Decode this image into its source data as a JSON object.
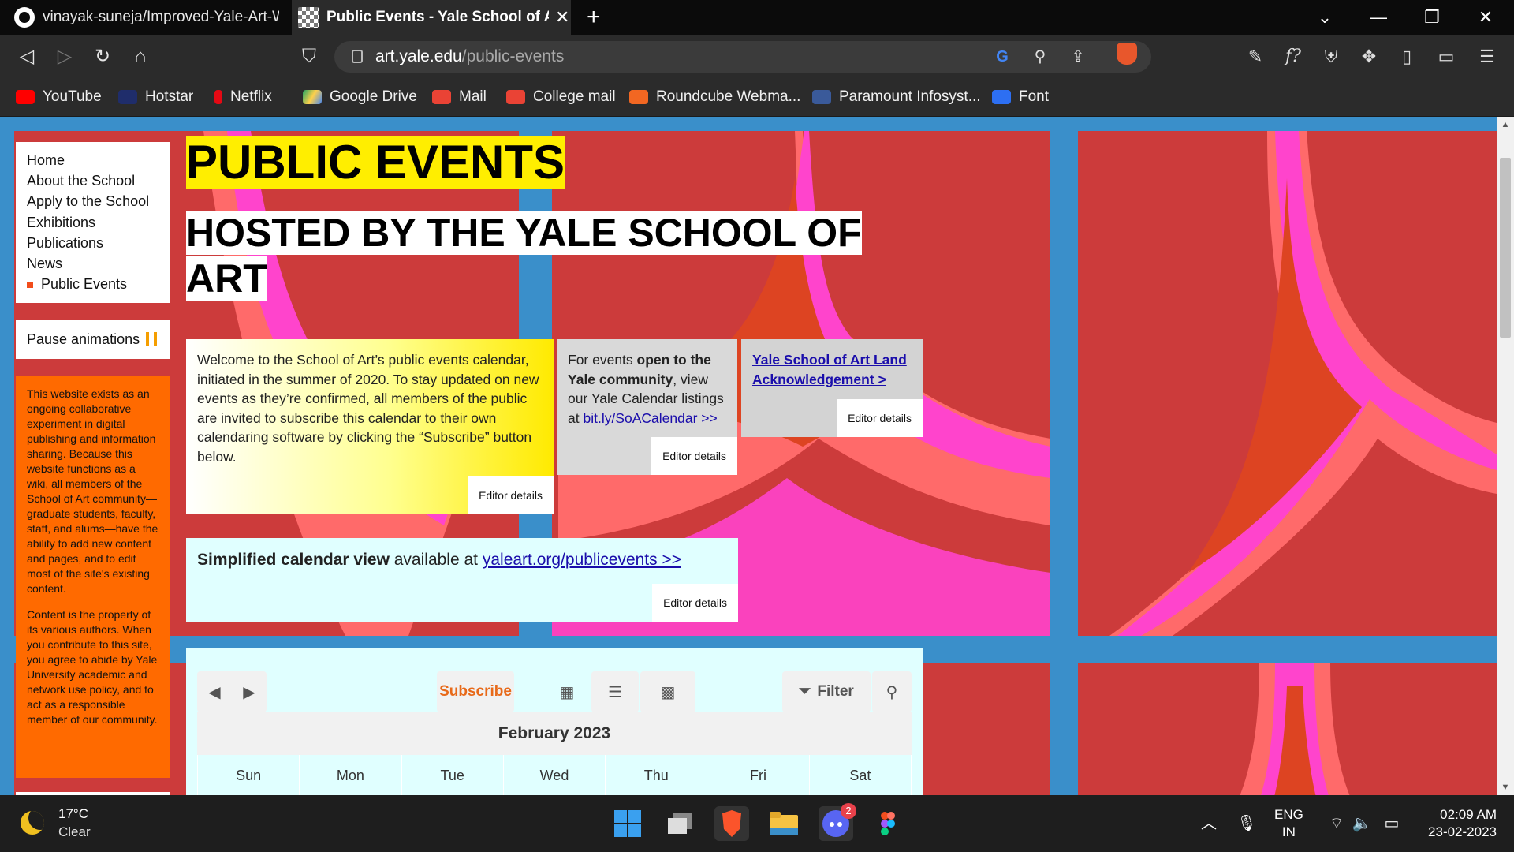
{
  "browser": {
    "tabs": [
      {
        "title": "vinayak-suneja/Improved-Yale-Art-We",
        "favicon": "github-icon"
      },
      {
        "title": "Public Events - Yale School of Art",
        "favicon": "checker-icon",
        "close": "✕"
      }
    ],
    "new_tab": "+",
    "url_host": "art.yale.edu",
    "url_path": "/public-events",
    "brave_shield_count": "1",
    "bookmarks": [
      {
        "label": "YouTube",
        "color": "#ff0000"
      },
      {
        "label": "Hotstar",
        "color": "#1f2d6b"
      },
      {
        "label": "Netflix",
        "color": "#e50914"
      },
      {
        "label": "Google Drive",
        "color": "#1fa463"
      },
      {
        "label": "Mail",
        "color": "#ea4335"
      },
      {
        "label": "College mail",
        "color": "#ea4335"
      },
      {
        "label": "Roundcube Webma...",
        "color": "#f26722"
      },
      {
        "label": "Paramount Infosyst...",
        "color": "#3a5a9a"
      },
      {
        "label": "Font",
        "color": "#2d6ff2"
      }
    ]
  },
  "page": {
    "nav": [
      "Home",
      "About the School",
      "Apply to the School",
      "Exhibitions",
      "Publications",
      "News",
      "Public Events"
    ],
    "pause_label": "Pause animations",
    "disclaimer_1": "This website exists as an ongoing collaborative experiment in digital publishing and information sharing. Because this website functions as a wiki, all members of the School of Art community—graduate students, faculty, staff, and alums—have the ability to add new content and pages, and to edit most of the site's existing content.",
    "disclaimer_2": "Content is the property of its various authors. When you contribute to this site, you agree to abide by Yale University academic and network use policy, and to act as a responsible member of our community.",
    "title": "PUBLIC EVENTS",
    "subtitle": "HOSTED BY THE YALE SCHOOL OF ART",
    "welcome_text": "Welcome to the School of Art’s public events calendar, initiated in the summer of 2020. To stay updated on new events as they’re confirmed, all members of the public are invited to subscribe this calendar to their own calendaring software by clicking the “Subscribe” button below.",
    "yale_pre": "For events ",
    "yale_bold": "open to the Yale community",
    "yale_mid": ", view our Yale Calendar listings at ",
    "yale_link": "bit.ly/SoACalendar >>",
    "land_link": "Yale School of Art Land Acknowledgement >",
    "cal_bold": "Simplified calendar view",
    "cal_mid": " available at ",
    "cal_link": "yaleart.org/publicevents >>",
    "editor_details": "Editor details",
    "calendar": {
      "subscribe": "Subscribe",
      "filter": "Filter",
      "month": "February 2023",
      "days": [
        "Sun",
        "Mon",
        "Tue",
        "Wed",
        "Thu",
        "Fri",
        "Sat"
      ]
    },
    "colors": {
      "tile_red": "#cc3b3b",
      "background_blue": "#3a8fca",
      "highlight_yellow": "#ffee00",
      "sidebar_orange": "#ff6a00"
    }
  },
  "taskbar": {
    "temp": "17°C",
    "condition": "Clear",
    "lang_1": "ENG",
    "lang_2": "IN",
    "time": "02:09 AM",
    "date": "23-02-2023",
    "discord_badge": "2"
  }
}
